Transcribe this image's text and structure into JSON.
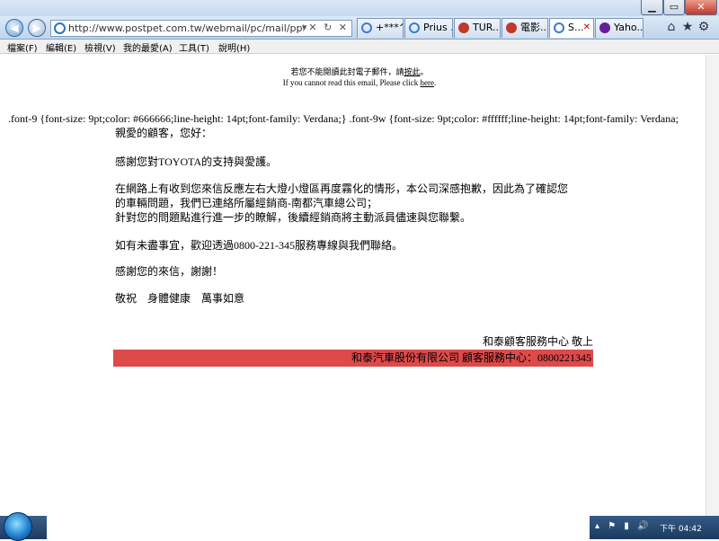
{
  "window": {
    "minimize": "▁",
    "maximize": "▭",
    "close": "✕"
  },
  "nav": {
    "back": "◀",
    "forward": "▶",
    "url": "http://www.postpet.com.tw/webmail/pc/mail/ppHtmlMailV",
    "addr_icons": "▾✕ ↻ ✕",
    "tabs": [
      {
        "label": "+***^...",
        "icon_color": "#3a7bd5"
      },
      {
        "label": "Prius ...",
        "icon_color": "#3a7bd5"
      },
      {
        "label": "TUR...",
        "icon_color": "#c0392b"
      },
      {
        "label": "電影...",
        "icon_color": "#c0392b"
      },
      {
        "label": "S...",
        "icon_color": "#3a7bd5",
        "active": true
      },
      {
        "label": "Yaho...",
        "icon_color": "#6a1b9a"
      }
    ],
    "tab_close": "✕",
    "toolbar_icons": [
      "⌂",
      "★",
      "⚙"
    ]
  },
  "menu": [
    "檔案(F)",
    "編輯(E)",
    "檢視(V)",
    "我的最愛(A)",
    "工具(T)",
    "說明(H)"
  ],
  "email": {
    "notice_zh_prefix": "若您不能閱讀此封電子郵件，請",
    "notice_zh_link": "按此",
    "notice_zh_suffix": "。",
    "notice_en_prefix": "If you cannot read this email, Please click ",
    "notice_en_link": "here",
    "notice_en_suffix": ".",
    "css_leak": ".font-9 {font-size: 9pt;color: #666666;line-height: 14pt;font-family: Verdana;} .font-9w {font-size: 9pt;color: #ffffff;line-height: 14pt;font-family: Verdana;",
    "greeting": "親愛的顧客，您好：",
    "thanks_support": "感謝您對TOYOTA的支持與愛護。",
    "para1_line1": "在網路上有收到您來信反應左右大燈小燈區再度霧化的情形，本公司深感抱歉，因此為了確認您",
    "para1_line2": "的車輛問題，我們已連絡所屬經銷商-南都汽車總公司；",
    "para1_line3": "針對您的問題點進行進一步的瞭解，後續經銷商將主動派員儘速與您聯繫。",
    "contact": "如有未盡事宜，歡迎透過0800-221-345服務專線與我們聯絡。",
    "thanks_letter": "感謝您的來信，謝謝！",
    "closing": "敬祝　身體健康　萬事如意",
    "signature": "和泰顧客服務中心 敬上",
    "footer": "和泰汽車股份有限公司 顧客服務中心：0800221345"
  },
  "taskbar": {
    "tray_icons": "▴ ⚑ ▮ 🔊",
    "clock": "下午 04:42"
  }
}
